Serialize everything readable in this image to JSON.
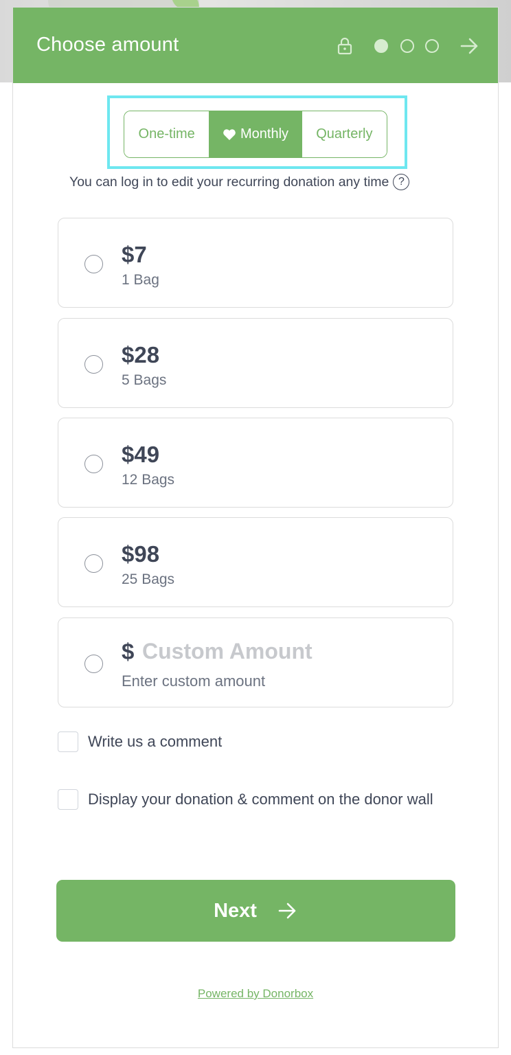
{
  "header": {
    "title": "Choose amount",
    "steps": {
      "current": 1,
      "total": 3
    }
  },
  "frequency": {
    "options": [
      "One-time",
      "Monthly",
      "Quarterly"
    ],
    "selected": "Monthly"
  },
  "recurring_note": "You can log in to edit your recurring donation any time",
  "help_symbol": "?",
  "amounts": [
    {
      "value": "$7",
      "desc": "1 Bag"
    },
    {
      "value": "$28",
      "desc": "5 Bags"
    },
    {
      "value": "$49",
      "desc": "12 Bags"
    },
    {
      "value": "$98",
      "desc": "25 Bags"
    }
  ],
  "custom_amount": {
    "prefix": "$",
    "placeholder": "Custom Amount",
    "desc": "Enter custom amount"
  },
  "checkboxes": {
    "comment": "Write us a comment",
    "donor_wall": "Display your donation & comment on the donor wall"
  },
  "next_button": "Next",
  "powered_by": "Powered by Donorbox",
  "colors": {
    "brand_green": "#75b565",
    "highlight": "#6ee7f0",
    "text_dark": "#3f4657"
  },
  "icons": [
    "lock-icon",
    "arrow-right-icon",
    "heart-icon",
    "help-icon"
  ]
}
